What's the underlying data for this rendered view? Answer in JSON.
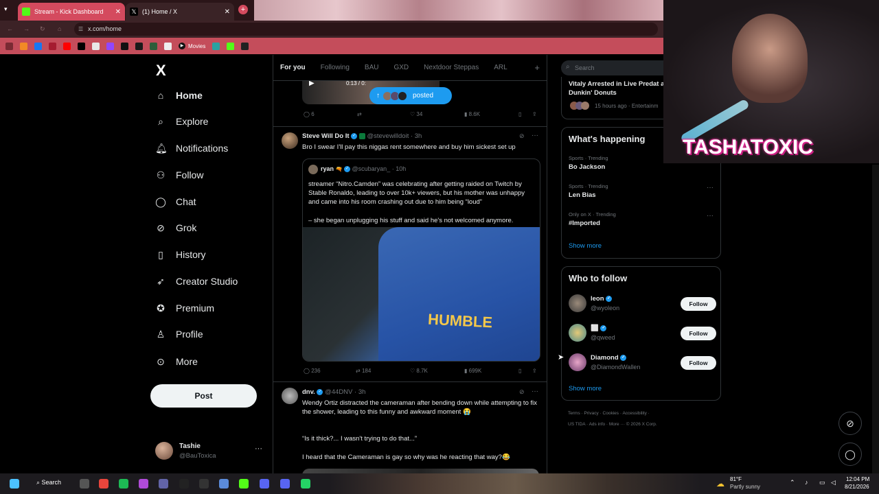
{
  "browser": {
    "tabs": [
      {
        "title": "Stream - Kick Dashboard",
        "active": true
      },
      {
        "title": "(1) Home / X",
        "active": false
      }
    ],
    "url": "x.com/home",
    "bookmarks": {
      "movies_label": "Movies"
    }
  },
  "nav": {
    "logo": "X",
    "items": [
      {
        "label": "Home",
        "icon": "home-icon"
      },
      {
        "label": "Explore",
        "icon": "search-icon"
      },
      {
        "label": "Notifications",
        "icon": "bell-icon"
      },
      {
        "label": "Follow",
        "icon": "person-add-icon"
      },
      {
        "label": "Chat",
        "icon": "chat-icon"
      },
      {
        "label": "Grok",
        "icon": "grok-icon"
      },
      {
        "label": "History",
        "icon": "bookmark-icon"
      },
      {
        "label": "Creator Studio",
        "icon": "rocket-icon"
      },
      {
        "label": "Premium",
        "icon": "verified-icon"
      },
      {
        "label": "Profile",
        "icon": "person-icon"
      },
      {
        "label": "More",
        "icon": "more-icon"
      }
    ],
    "post_label": "Post",
    "user": {
      "name": "Tashie",
      "handle": "@BauToxica"
    }
  },
  "feed": {
    "tabs": [
      "For you",
      "Following",
      "BAU",
      "GXD",
      "Nextdoor Steppas",
      "ARL"
    ],
    "video": {
      "time": "0:13 / 0:",
      "posted_label": "posted"
    },
    "post0_actions": {
      "replies": "6",
      "reposts": "",
      "likes": "34",
      "views": "8.6K"
    },
    "post1": {
      "name": "Steve Will Do It",
      "handle": "@stevewilldoit",
      "time": "· 3h",
      "text": "Bro I swear I'll pay this niggas rent somewhere and buy him sickest set up",
      "quote": {
        "name": "ryan",
        "handle": "@scubaryan_",
        "time": "· 10h",
        "text1": "streamer “Nitro.Camden” was celebrating after getting raided on Twitch by Stable Ronaldo, leading to over 10k+ viewers, but his mother was unhappy and came into his room crashing out due to him being “loud”",
        "text2": "– she began unplugging his stuff and said he's not welcomed anymore.",
        "shirt_text": "HUMBLE"
      },
      "actions": {
        "replies": "236",
        "reposts": "184",
        "likes": "8.7K",
        "views": "699K"
      }
    },
    "post2": {
      "name": "dnv.",
      "handle": "@44DNV",
      "time": "· 3h",
      "text1": "Wendy Ortiz distracted the cameraman after bending down while attempting to fix the shower, leading to this funny and awkward moment 😭",
      "text2": "“Is it thick?... I wasn't trying to do that...”",
      "text3": "I heard that the Cameraman is gay so why was he reacting that way?😂"
    }
  },
  "right": {
    "search_placeholder": "Search",
    "top_story": {
      "title": "Vitaly Arrested in Live Predat at Dunkin' Donuts",
      "meta": "15 hours ago · Entertainm"
    },
    "happening": {
      "title": "What's happening",
      "trends": [
        {
          "category": "Sports · Trending",
          "name": "Bo Jackson"
        },
        {
          "category": "Sports · Trending",
          "name": "Len Bias"
        },
        {
          "category": "Only on X · Trending",
          "name": "#Imported"
        }
      ],
      "show_more": "Show more"
    },
    "who_to_follow": {
      "title": "Who to follow",
      "users": [
        {
          "name": "leon",
          "handle": "@wyoleon"
        },
        {
          "name": "⬜",
          "handle": "@qweed"
        },
        {
          "name": "Diamond",
          "handle": "@DiamondWallen"
        }
      ],
      "follow_label": "Follow",
      "show_more": "Show more"
    },
    "footer": {
      "line1": "Terms · Privacy · Cookies · Accessibility ·",
      "line2": "US TIDA · Ads info · More ··· © 2026 X Corp."
    }
  },
  "webcam": {
    "title": "TASHATOXIC"
  },
  "taskbar": {
    "search_label": "Search",
    "weather_temp": "81°F",
    "weather_desc": "Partly sunny",
    "time": "12:04 PM",
    "date": "8/21/2026"
  },
  "colors": {
    "accent": "#1d9bf0",
    "kick_tab": "#d44a5e",
    "bookmarks_bar": "#c44d5b",
    "cam_title_glow": "#e0349a"
  }
}
